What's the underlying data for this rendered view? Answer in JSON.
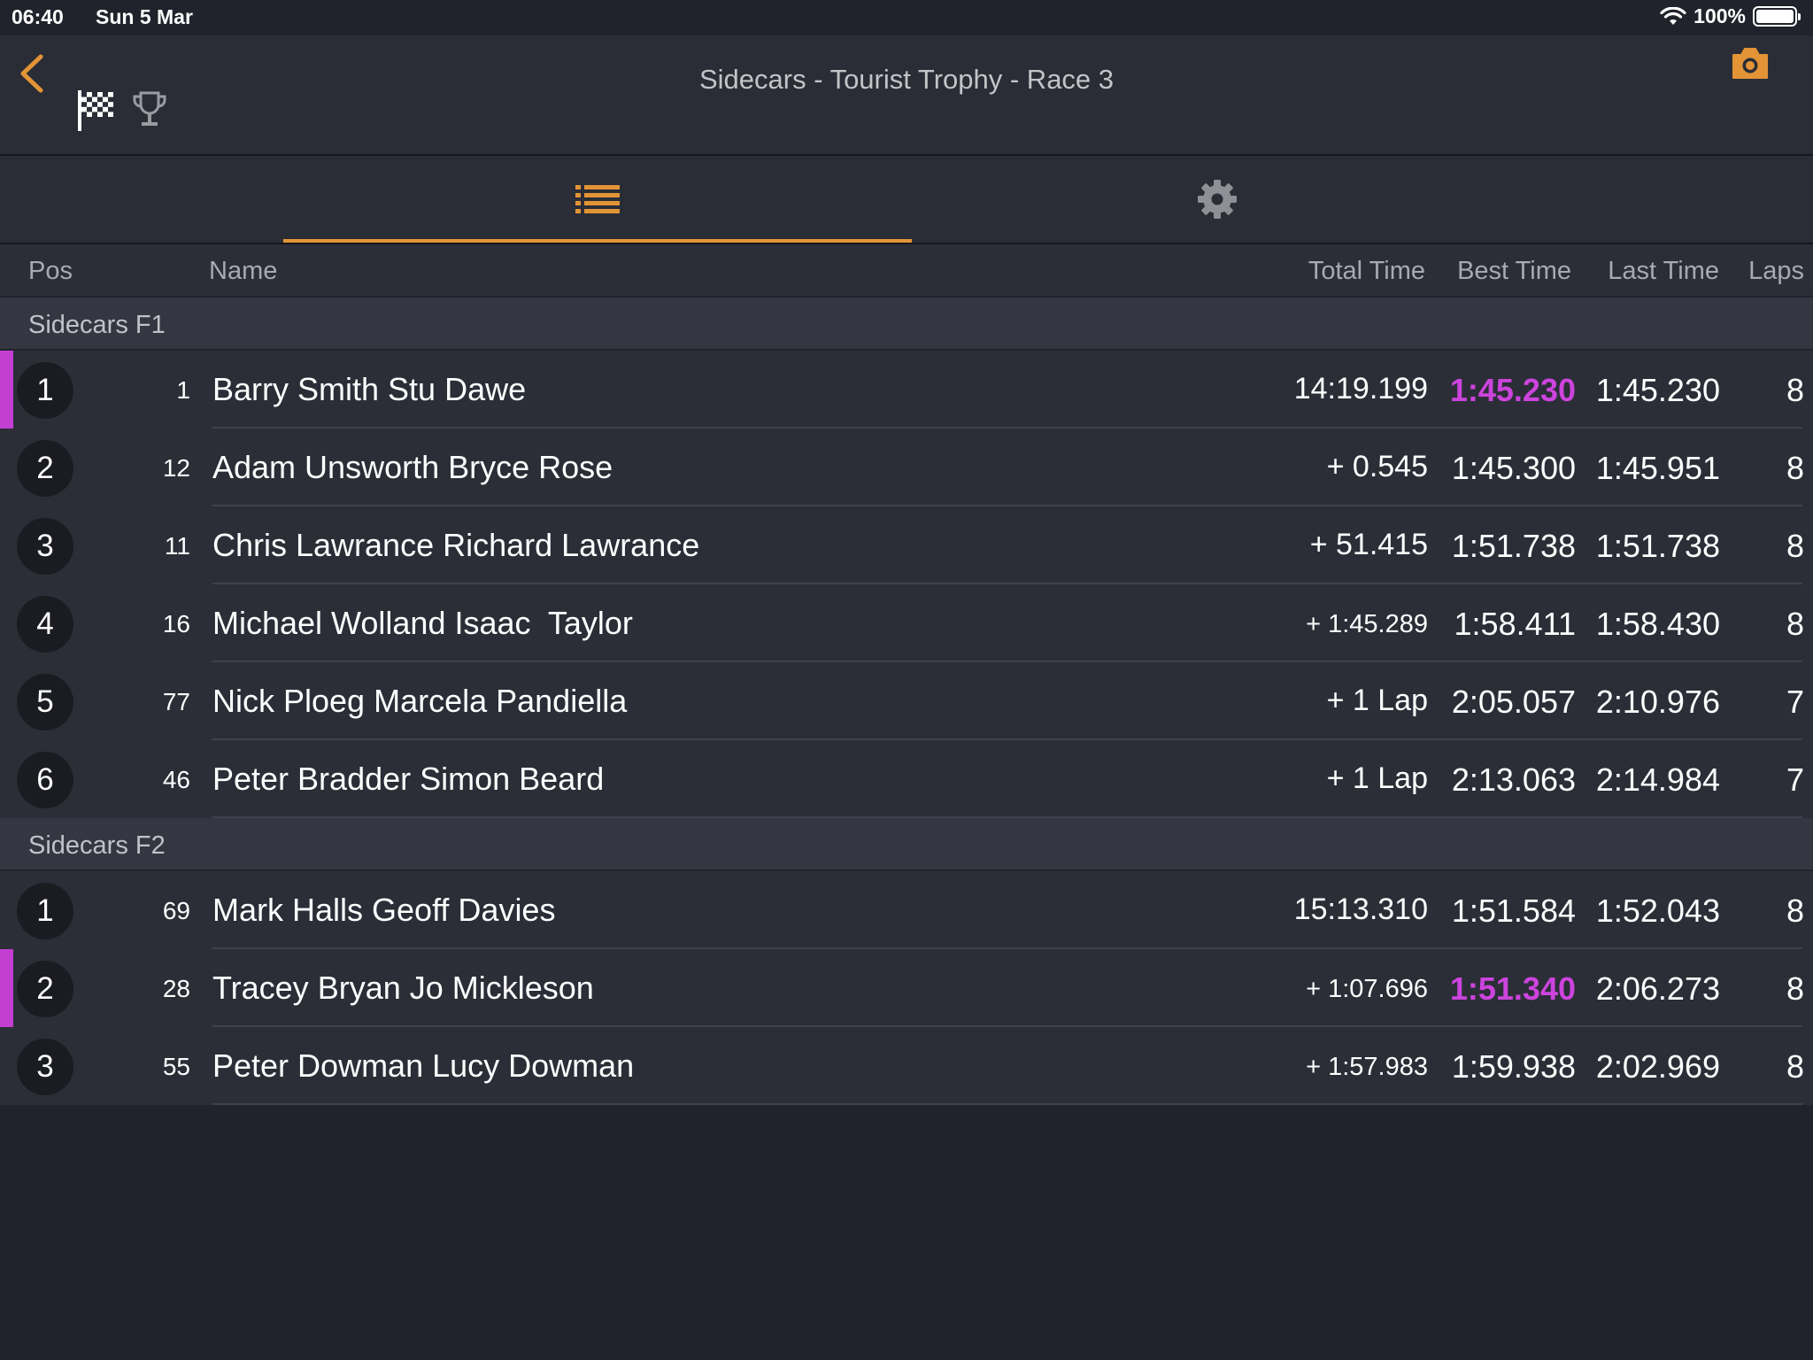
{
  "status_bar": {
    "time": "06:40",
    "date": "Sun 5 Mar",
    "battery": "100%",
    "battery_level": 1.0
  },
  "nav": {
    "title": "Sidecars - Tourist Trophy - Race 3",
    "back_icon": "chevron-left-icon",
    "flag_icon": "checkered-flag-icon",
    "trophy_icon": "trophy-icon",
    "camera_icon": "camera-icon"
  },
  "tabs": [
    {
      "icon": "list-icon",
      "selected": true
    },
    {
      "icon": "gear-icon",
      "selected": false
    }
  ],
  "columns": {
    "pos": "Pos",
    "name": "Name",
    "total": "Total Time",
    "best": "Best Time",
    "last": "Last Time",
    "laps": "Laps"
  },
  "sections": [
    {
      "title": "Sidecars F1",
      "rows": [
        {
          "pos": "1",
          "num": "1",
          "name": "Barry Smith Stu Dawe",
          "total": "14:19.199",
          "best": "1:45.230",
          "last": "1:45.230",
          "laps": "8",
          "fastest": true
        },
        {
          "pos": "2",
          "num": "12",
          "name": "Adam Unsworth Bryce Rose",
          "total": "+ 0.545",
          "best": "1:45.300",
          "last": "1:45.951",
          "laps": "8",
          "fastest": false
        },
        {
          "pos": "3",
          "num": "11",
          "name": "Chris Lawrance Richard Lawrance",
          "total": "+ 51.415",
          "best": "1:51.738",
          "last": "1:51.738",
          "laps": "8",
          "fastest": false
        },
        {
          "pos": "4",
          "num": "16",
          "name": "Michael Wolland Isaac  Taylor",
          "total": "+ 1:45.289",
          "best": "1:58.411",
          "last": "1:58.430",
          "laps": "8",
          "fastest": false
        },
        {
          "pos": "5",
          "num": "77",
          "name": "Nick Ploeg Marcela Pandiella",
          "total": "+ 1 Lap",
          "best": "2:05.057",
          "last": "2:10.976",
          "laps": "7",
          "fastest": false
        },
        {
          "pos": "6",
          "num": "46",
          "name": "Peter Bradder Simon Beard",
          "total": "+ 1 Lap",
          "best": "2:13.063",
          "last": "2:14.984",
          "laps": "7",
          "fastest": false
        }
      ]
    },
    {
      "title": "Sidecars F2",
      "rows": [
        {
          "pos": "1",
          "num": "69",
          "name": "Mark Halls Geoff Davies",
          "total": "15:13.310",
          "best": "1:51.584",
          "last": "1:52.043",
          "laps": "8",
          "fastest": false
        },
        {
          "pos": "2",
          "num": "28",
          "name": "Tracey Bryan Jo Mickleson",
          "total": "+ 1:07.696",
          "best": "1:51.340",
          "last": "2:06.273",
          "laps": "8",
          "fastest": true
        },
        {
          "pos": "3",
          "num": "55",
          "name": "Peter Dowman Lucy Dowman",
          "total": "+ 1:57.983",
          "best": "1:59.938",
          "last": "2:02.969",
          "laps": "8",
          "fastest": false
        }
      ]
    }
  ],
  "colors": {
    "accent": "#e39436",
    "fastest": "#cc44dd",
    "background": "#20232b",
    "row": "#2b2e37",
    "section": "#343741"
  }
}
